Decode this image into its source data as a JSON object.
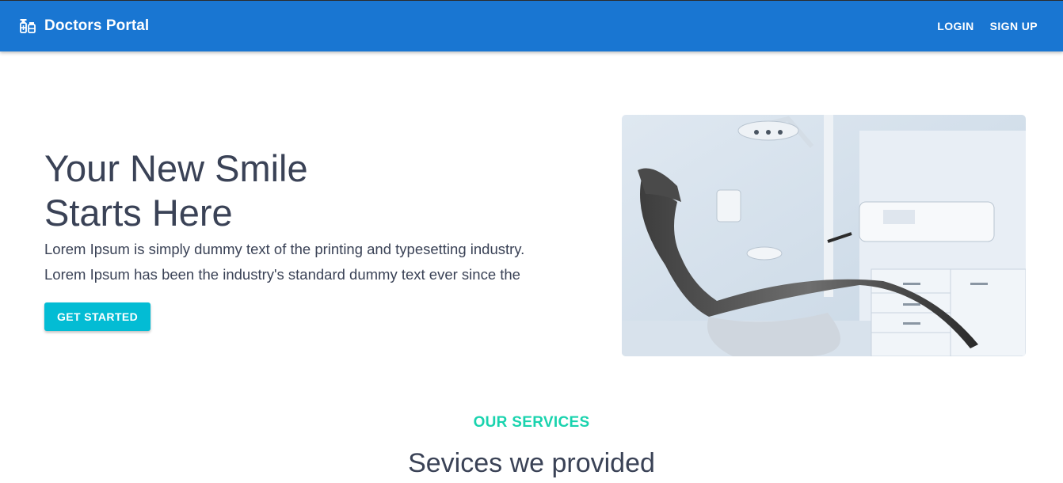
{
  "appbar": {
    "title": "Doctors Portal",
    "icon": "medication-icon",
    "color": "#1976d2",
    "nav": [
      {
        "label": "LOGIN"
      },
      {
        "label": "SIGN UP"
      }
    ]
  },
  "hero": {
    "title_line1": "Your New Smile",
    "title_line2": "Starts Here",
    "text_line1": "Lorem Ipsum is simply dummy text of the printing and typesetting industry.",
    "text_line2": "Lorem Ipsum has been the industry's standard dummy text ever since the",
    "cta_label": "GET STARTED",
    "cta_color": "#03bcd4",
    "image": "dental-chair-image"
  },
  "services": {
    "eyebrow": "OUR SERVICES",
    "title": "Sevices we provided",
    "accent": "#19d3ae"
  }
}
